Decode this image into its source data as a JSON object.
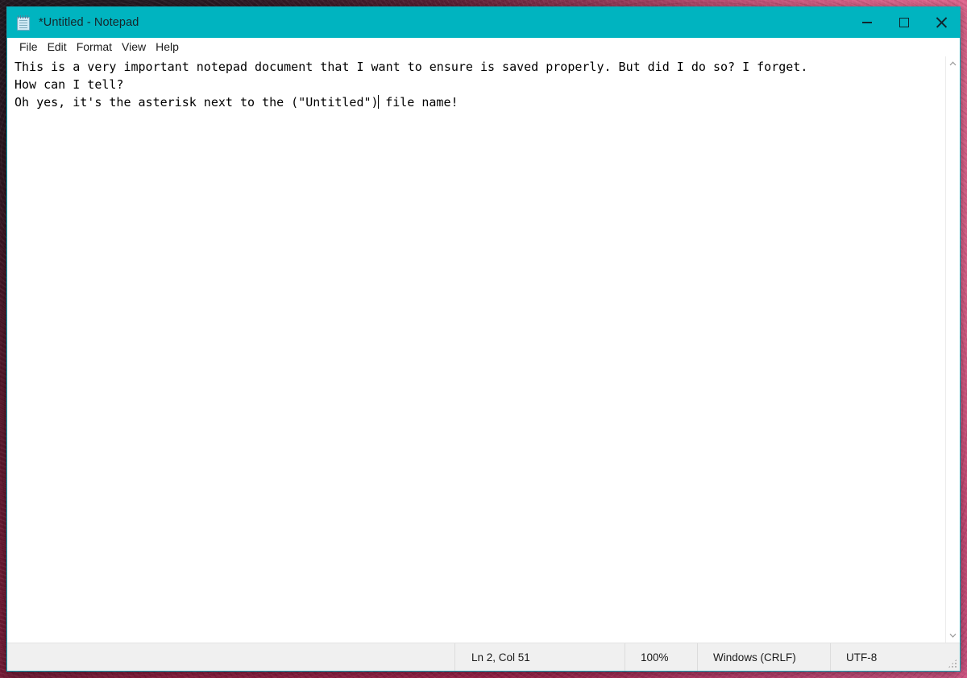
{
  "window": {
    "title": "*Untitled - Notepad",
    "icon": "notepad-icon",
    "accent_color": "#00b4c0",
    "border_color": "#0fa9b8",
    "controls": {
      "minimize": "minimize-icon",
      "maximize": "maximize-icon",
      "close": "close-icon"
    }
  },
  "menubar": {
    "items": [
      {
        "label": "File"
      },
      {
        "label": "Edit"
      },
      {
        "label": "Format"
      },
      {
        "label": "View"
      },
      {
        "label": "Help"
      }
    ]
  },
  "editor": {
    "line1": "This is a very important notepad document that I want to ensure is saved properly. But did I do so? I forget.",
    "line2": "How can I tell?",
    "line3a": "Oh yes, it's the asterisk next to the (\"Untitled\")",
    "line3b": " file name!",
    "caret_visible": true,
    "text_color": "#000000",
    "background_color": "#ffffff"
  },
  "scrollbar": {
    "up_arrow": "chevron-up-icon",
    "down_arrow": "chevron-down-icon"
  },
  "statusbar": {
    "cursor_position": "Ln 2, Col 51",
    "zoom": "100%",
    "line_ending": "Windows (CRLF)",
    "encoding": "UTF-8",
    "background_color": "#f0f0f0"
  }
}
